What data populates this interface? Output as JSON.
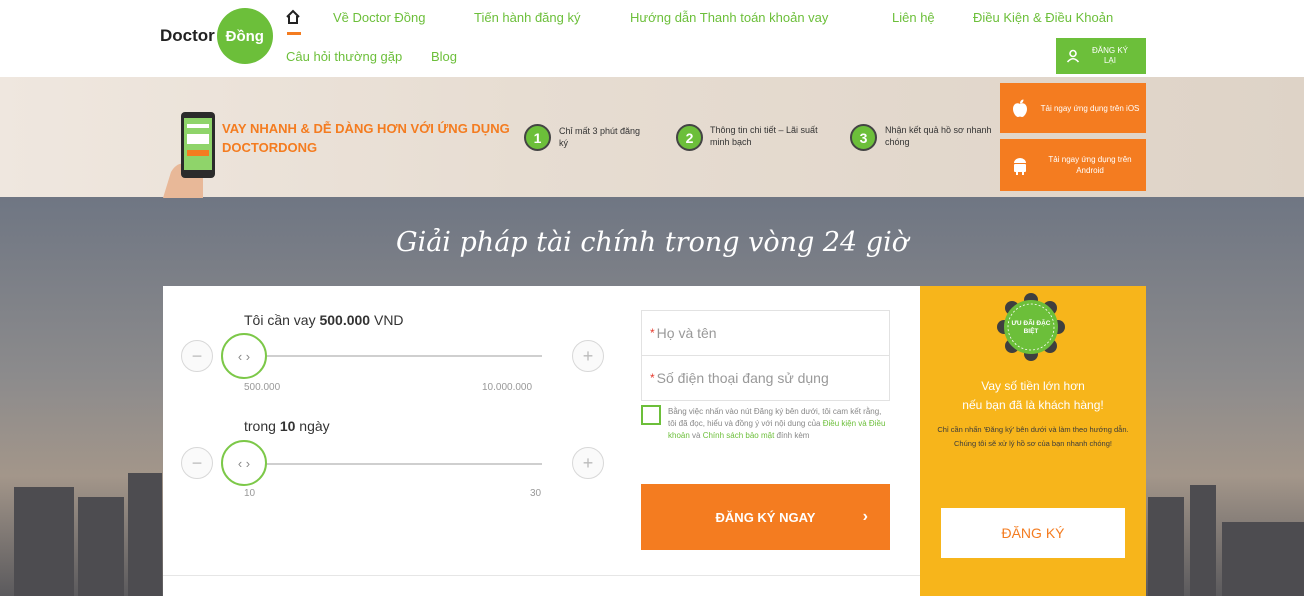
{
  "header": {
    "logo_doctor": "Doctor",
    "logo_dong": "Đồng",
    "nav": [
      {
        "label": "Về Doctor Đồng"
      },
      {
        "label": "Tiến hành đăng ký"
      },
      {
        "label": "Hướng dẫn Thanh toán khoản vay"
      },
      {
        "label": "Liên hệ"
      },
      {
        "label": "Điều Kiện & Điều Khoản"
      },
      {
        "label": "Câu hỏi thường gặp"
      },
      {
        "label": "Blog"
      }
    ],
    "login_button": "ĐĂNG KÝ LẠI"
  },
  "banner": {
    "title": "VAY NHANH & DỄ DÀNG HƠN VỚI ỨNG DỤNG DOCTORDONG",
    "steps": [
      {
        "number": "1",
        "text": "Chỉ mất 3 phút đăng ký"
      },
      {
        "number": "2",
        "text": "Thông tin chi tiết – Lãi suất minh bạch"
      },
      {
        "number": "3",
        "text": "Nhận kết quả hồ sơ nhanh chóng"
      }
    ],
    "ios_button": "Tải ngay ứng dụng trên iOS",
    "android_button": "Tải ngay ứng dụng trên Android"
  },
  "hero": {
    "title": "Giải pháp tài chính trong vòng 24 giờ"
  },
  "form": {
    "amount_prefix": "Tôi cần vay ",
    "amount_value": "500.000",
    "amount_unit": " VND",
    "amount_min": "500.000",
    "amount_max": "10.000.000",
    "amount_fraction": 0.0,
    "days_prefix": "trong ",
    "days_value": "10",
    "days_suffix": " ngày",
    "days_min": "10",
    "days_max": "30",
    "days_fraction": 0.0,
    "minus": "−",
    "plus": "+",
    "name_placeholder": "Họ và tên",
    "phone_placeholder": "Số điện thoại đang sử dụng",
    "agree_text_1": "Bằng việc nhấn vào nút Đăng ký bên dưới, tôi cam kết rằng, tôi đã đọc, hiểu và đồng ý với nội dung của ",
    "agree_link_1": "Điều kiện và Điều khoản",
    "agree_text_2": " và ",
    "agree_link_2": "Chính sách bảo mật",
    "agree_text_3": " đính kèm",
    "submit_button": "ĐĂNG KÝ NGAY",
    "submit_chevron": "›"
  },
  "promo": {
    "badge_text": "ƯU ĐÃI ĐẶC BIỆT",
    "title_line1": "Vay số tiền lớn hơn",
    "title_line2": "nếu bạn đã là khách hàng!",
    "text_line1": "Chỉ cần nhấn 'Đăng ký' bên dưới và làm theo hướng dẫn.",
    "text_line2": "Chúng tôi sẽ xử lý hồ sơ của bạn nhanh chóng!",
    "button": "ĐĂNG KÝ"
  },
  "colors": {
    "brand_green": "#6cbf3a",
    "brand_orange": "#f47c20",
    "promo_yellow": "#f7b51b"
  }
}
